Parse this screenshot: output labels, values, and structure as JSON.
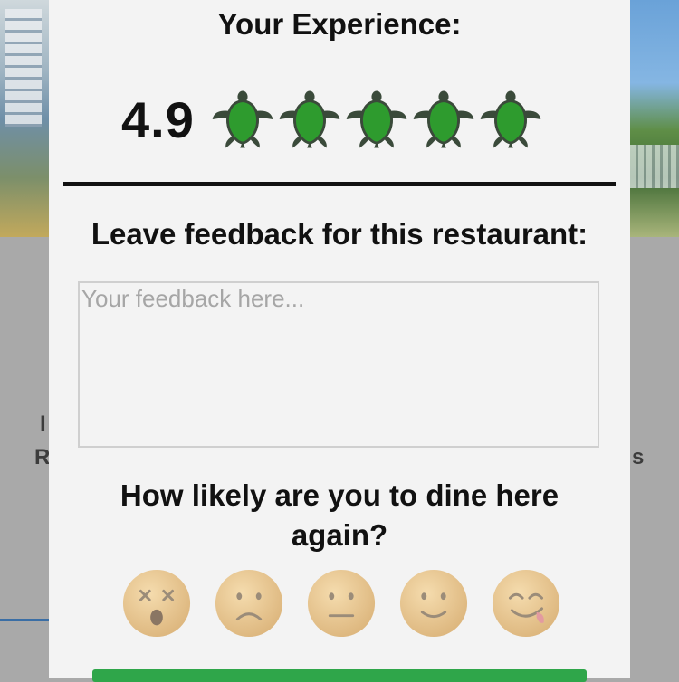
{
  "modal": {
    "title": "Your Experience:",
    "rating": {
      "value_text": "4.9",
      "value": 4.9,
      "max": 5,
      "icon": "turtle-icon",
      "fill_color": "#2e9b2e",
      "empty_color": "#d6d6d6"
    },
    "feedback": {
      "label": "Leave feedback for this restaurant:",
      "placeholder": "Your feedback here...",
      "value": ""
    },
    "likelihood": {
      "question": "How likely are you to dine here again?",
      "options": [
        {
          "icon": "dizzy-face-icon"
        },
        {
          "icon": "frowning-face-icon"
        },
        {
          "icon": "neutral-face-icon"
        },
        {
          "icon": "slightly-smiling-face-icon"
        },
        {
          "icon": "yummy-face-icon"
        }
      ]
    },
    "submit_color": "#2fa64a"
  },
  "background": {
    "left_letters": [
      "I",
      "R"
    ],
    "right_letters": [
      "s"
    ]
  }
}
